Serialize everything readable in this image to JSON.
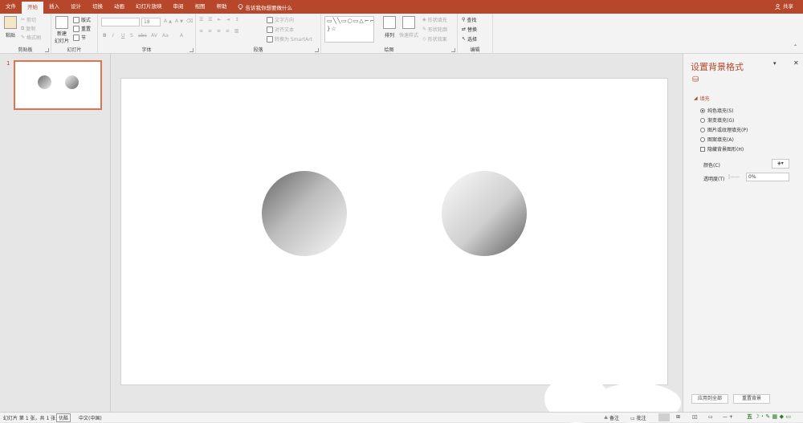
{
  "tabs": [
    "文件",
    "开始",
    "插入",
    "设计",
    "切换",
    "动画",
    "幻灯片放映",
    "审阅",
    "视图",
    "帮助"
  ],
  "tell_me": "告诉我你想要做什么",
  "share": "共享",
  "ribbon": {
    "clipboard": {
      "paste": "粘贴",
      "cut": "剪切",
      "copy": "复制",
      "format_painter": "格式刷",
      "label": "剪贴板"
    },
    "slides": {
      "new_slide": "新建",
      "new_slide_2": "幻灯片",
      "layout": "版式",
      "reset": "重置",
      "section": "节",
      "label": "幻灯片"
    },
    "font": {
      "font_size": "18",
      "label": "字体",
      "buttons": [
        "B",
        "I",
        "U",
        "S",
        "abc",
        "AV",
        "Aa",
        "A"
      ]
    },
    "paragraph": {
      "text_direction": "文字方向",
      "align_text": "对齐文本",
      "smartart": "转换为 SmartArt",
      "label": "段落"
    },
    "drawing": {
      "shapes_preview": "▭╲╲▭○▭△⌐⌐⇨◇{ }☆",
      "arrange": "排列",
      "quick_styles": "快速样式",
      "shape_fill": "形状填充",
      "shape_outline": "形状轮廓",
      "shape_effects": "形状效果",
      "label": "绘图"
    },
    "editing": {
      "find": "查找",
      "replace": "替换",
      "select": "选择",
      "label": "编辑"
    }
  },
  "thumbnails": [
    {
      "number": "1"
    }
  ],
  "format_pane": {
    "title": "设置背景格式",
    "section": "填充",
    "options": [
      {
        "label": "纯色填充(S)",
        "selected": true
      },
      {
        "label": "渐变填充(G)",
        "selected": false
      },
      {
        "label": "图片或纹理填充(P)",
        "selected": false
      },
      {
        "label": "图案填充(A)",
        "selected": false
      }
    ],
    "hide_background": "隐藏背景图形(H)",
    "color_label": "颜色(C)",
    "transparency_label": "透明度(T)",
    "transparency_value": "0%",
    "apply_all": "应用到全部",
    "reset": "重置背景"
  },
  "status": {
    "slide_info": "幻灯片 第 1 张，共 1 张",
    "tooltip": "优酷",
    "language": "中文(中国)",
    "notes": "备注",
    "comments": "批注"
  },
  "colors": {
    "accent": "#b7472a",
    "selection": "#e3704e"
  }
}
